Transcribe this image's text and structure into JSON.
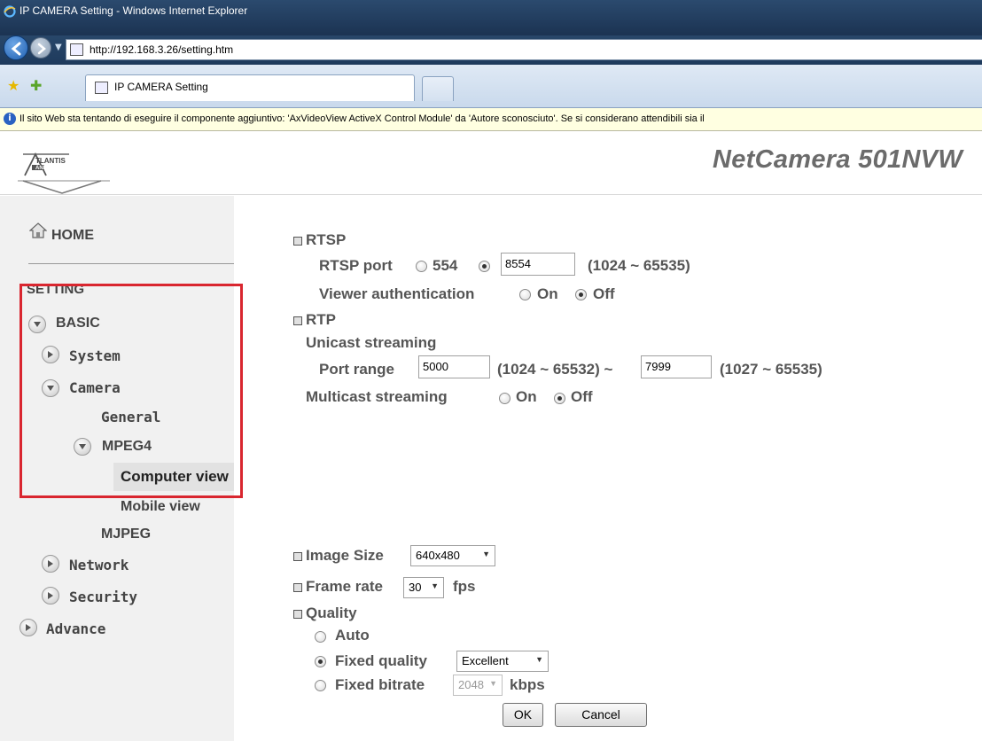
{
  "browser": {
    "window_title": "IP CAMERA Setting - Windows Internet Explorer",
    "url": "http://192.168.3.26/setting.htm",
    "tab_label": "IP CAMERA Setting",
    "infobar_message": "Il sito Web sta tentando di eseguire il componente aggiuntivo: 'AxVideoView ActiveX Control Module' da 'Autore sconosciuto'. Se si considerano attendibili sia il"
  },
  "header": {
    "logo_text": "ATLANTIS LAND",
    "product": "NetCamera 501NVW"
  },
  "sidebar": {
    "home": "HOME",
    "setting": "SETTING",
    "basic": "BASIC",
    "system": "System",
    "camera": "Camera",
    "general": "General",
    "mpeg4": "MPEG4",
    "computer_view": "Computer view",
    "mobile_view": "Mobile view",
    "mjpeg": "MJPEG",
    "network": "Network",
    "security": "Security",
    "advance": "Advance"
  },
  "rtsp": {
    "heading": "RTSP",
    "port_label": "RTSP port",
    "default_port": "554",
    "port_value": "8554",
    "port_range": "(1024 ~ 65535)",
    "auth_label": "Viewer authentication",
    "on": "On",
    "off": "Off"
  },
  "rtp": {
    "heading": "RTP",
    "unicast_label": "Unicast streaming",
    "port_range_label": "Port range",
    "port_from": "5000",
    "from_range": "(1024 ~ 65532) ~",
    "port_to": "7999",
    "to_range": "(1027 ~ 65535)",
    "multicast_label": "Multicast streaming",
    "on": "On",
    "off": "Off"
  },
  "video": {
    "image_size_label": "Image Size",
    "image_size_value": "640x480",
    "frame_rate_label": "Frame rate",
    "frame_rate_value": "30",
    "fps": "fps",
    "quality_label": "Quality",
    "auto_label": "Auto",
    "fixed_quality_label": "Fixed quality",
    "fixed_quality_value": "Excellent",
    "fixed_bitrate_label": "Fixed bitrate",
    "bitrate_value": "2048",
    "kbps": "kbps"
  },
  "buttons": {
    "ok": "OK",
    "cancel": "Cancel"
  }
}
